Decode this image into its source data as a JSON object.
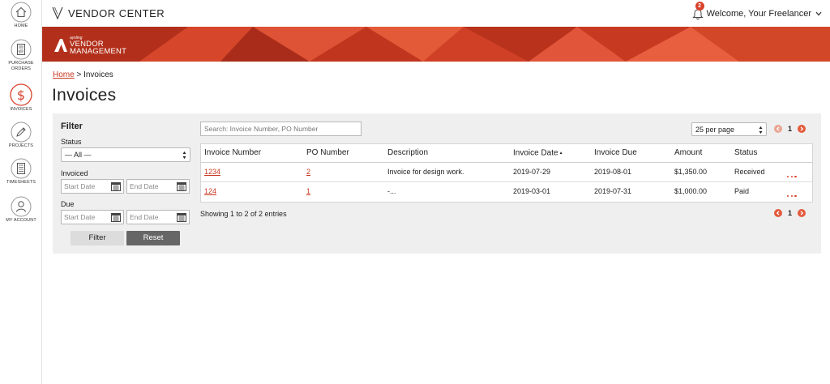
{
  "nav": {
    "items": [
      {
        "label": "HOME",
        "icon": "home-icon"
      },
      {
        "label": "PURCHASE\nORDERS",
        "icon": "purchase-orders-icon"
      },
      {
        "label": "INVOICES",
        "icon": "dollar-icon",
        "active": true
      },
      {
        "label": "PROJECTS",
        "icon": "pencil-icon"
      },
      {
        "label": "TIMESHEETS",
        "icon": "timesheet-icon"
      },
      {
        "label": "MY ACCOUNT",
        "icon": "user-icon"
      }
    ]
  },
  "header": {
    "title": "VENDOR CENTER",
    "notification_count": "2",
    "welcome": "Welcome, Your Freelancer"
  },
  "banner": {
    "logo_small": "aysling",
    "logo_line1": "VENDOR",
    "logo_line2": "MANAGEMENT"
  },
  "breadcrumb": {
    "home": "Home",
    "separator": ">",
    "current": "Invoices"
  },
  "page": {
    "title": "Invoices"
  },
  "filter": {
    "heading": "Filter",
    "status_label": "Status",
    "status_value": "— All —",
    "invoiced_label": "Invoiced",
    "due_label": "Due",
    "start_placeholder": "Start Date",
    "end_placeholder": "End Date",
    "filter_button": "Filter",
    "reset_button": "Reset"
  },
  "search": {
    "placeholder": "Search: Invoice Number, PO Number"
  },
  "paging": {
    "per_page": "25 per page",
    "current_page": "1"
  },
  "table": {
    "columns": [
      "Invoice Number",
      "PO Number",
      "Description",
      "Invoice Date",
      "Invoice Due",
      "Amount",
      "Status"
    ],
    "rows": [
      {
        "invoice": "1234",
        "po": "2",
        "description": "Invoice for design work.",
        "date": "2019-07-29",
        "due": "2019-08-01",
        "amount": "$1,350.00",
        "status": "Received"
      },
      {
        "invoice": "124",
        "po": "1",
        "description": "-...",
        "date": "2019-03-01",
        "due": "2019-07-31",
        "amount": "$1,000.00",
        "status": "Paid"
      }
    ]
  },
  "entries_info": "Showing 1 to 2 of 2 entries",
  "colors": {
    "accent": "#c8381f",
    "badge": "#d9412b",
    "pager": "#e45a3c",
    "panel": "#efefef"
  }
}
